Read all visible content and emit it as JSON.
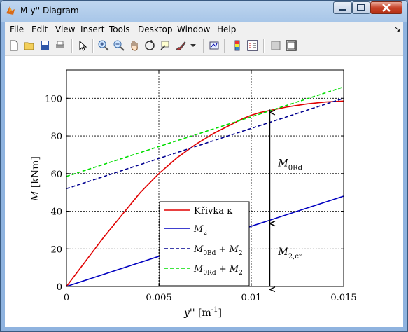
{
  "window": {
    "title": "M-y'' Diagram"
  },
  "menu": [
    "File",
    "Edit",
    "View",
    "Insert",
    "Tools",
    "Desktop",
    "Window",
    "Help"
  ],
  "toolbar_icons": [
    "new-figure-icon",
    "open-file-icon",
    "save-icon",
    "print-icon",
    "select-arrow-icon",
    "zoom-in-icon",
    "zoom-out-icon",
    "pan-hand-icon",
    "rotate-3d-icon",
    "data-cursor-icon",
    "brush-icon",
    "link-plot-icon",
    "colorbar-icon",
    "legend-icon",
    "hide-plot-tools-icon",
    "show-plot-tools-icon"
  ],
  "colors": {
    "red": "#e00000",
    "blue": "#0000c0",
    "navy": "#000090",
    "green": "#00dd00"
  },
  "chart_data": {
    "type": "line",
    "xlabel": "y'' [m⁻¹]",
    "ylabel": "M [kNm]",
    "xlim": [
      0,
      0.015
    ],
    "ylim": [
      0,
      115
    ],
    "x_ticks": [
      "0",
      "0.005",
      "0.01",
      "0.015"
    ],
    "y_ticks": [
      "0",
      "20",
      "40",
      "60",
      "80",
      "100"
    ],
    "grid": true,
    "legend_position": "bottom-center",
    "series": [
      {
        "name": "Křivka κ",
        "style": "solid",
        "color": "#e00000",
        "x": [
          0,
          0.001,
          0.002,
          0.003,
          0.004,
          0.005,
          0.006,
          0.007,
          0.008,
          0.009,
          0.0095,
          0.01,
          0.0105,
          0.011,
          0.012,
          0.013,
          0.014,
          0.015
        ],
        "y": [
          0,
          13,
          26,
          38,
          50,
          60,
          68.5,
          75.5,
          81.5,
          86.5,
          89,
          91,
          92.5,
          93.5,
          95.5,
          97,
          98,
          98.5
        ]
      },
      {
        "name": "M2",
        "style": "solid",
        "color": "#0000c0",
        "x": [
          0,
          0.015
        ],
        "y": [
          0,
          48
        ]
      },
      {
        "name": "M0Ed + M2",
        "style": "dashed",
        "color": "#000090",
        "x": [
          0,
          0.015
        ],
        "y": [
          52,
          100
        ]
      },
      {
        "name": "M0Rd + M2",
        "style": "dashed",
        "color": "#00dd00",
        "x": [
          0,
          0.015
        ],
        "y": [
          58.5,
          106
        ]
      }
    ],
    "annotations": [
      {
        "label_main": "M",
        "label_sub": "0Rd",
        "x": 0.011,
        "y_from": 35,
        "y_to": 94
      },
      {
        "label_main": "M",
        "label_sub": "2,cr",
        "x": 0.011,
        "y_from": 0,
        "y_to": 35
      }
    ],
    "legend_entries": [
      {
        "text": "Křivka κ"
      },
      {
        "main": "M",
        "sub": "2"
      },
      {
        "main": "M",
        "sub": "0Ed",
        "plus": "+ M",
        "sub2": "2"
      },
      {
        "main": "M",
        "sub": "0Rd",
        "plus": "+ M",
        "sub2": "2"
      }
    ]
  }
}
